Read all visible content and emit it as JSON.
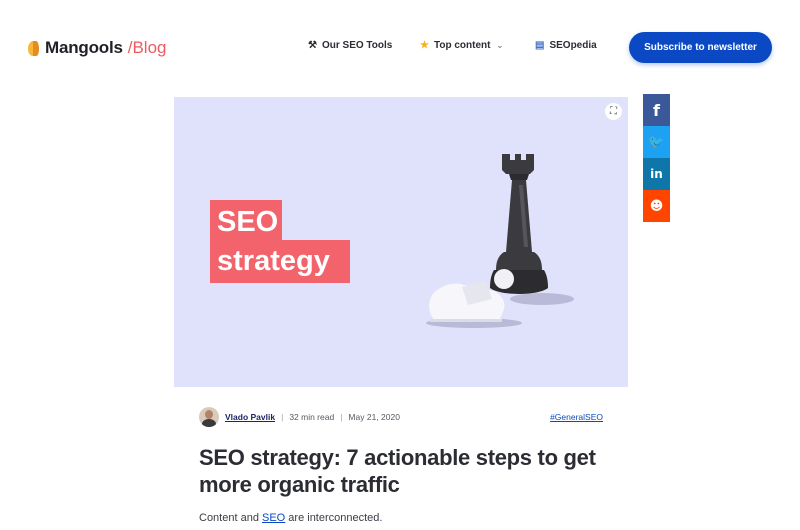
{
  "header": {
    "logo": {
      "name": "Mangools",
      "section": "/Blog"
    },
    "nav": [
      {
        "icon": "tools-icon",
        "label": "Our SEO Tools"
      },
      {
        "icon": "star-icon",
        "label": "Top content"
      },
      {
        "icon": "book-icon",
        "label": "SEOpedia"
      }
    ],
    "subscribe_label": "Subscribe to newsletter"
  },
  "hero": {
    "line1": "SEO",
    "line2": "strategy",
    "colors": {
      "background": "#e0e1fa",
      "badge": "#f2636b"
    }
  },
  "share": [
    {
      "network": "facebook",
      "glyph": "f"
    },
    {
      "network": "twitter",
      "glyph": "🐦"
    },
    {
      "network": "linkedin",
      "glyph": "in"
    },
    {
      "network": "reddit",
      "glyph": "☻"
    }
  ],
  "article": {
    "author": "Vlado Pavlik",
    "read_time": "32 min read",
    "date": "May 21, 2020",
    "tag": "#GeneralSEO",
    "title": "SEO strategy: 7 actionable steps to get more organic traffic",
    "intro_before": "Content and ",
    "intro_link": "SEO",
    "intro_after": " are interconnected."
  },
  "colors": {
    "accent": "#0b49c4",
    "brand": "#ee5b61"
  }
}
